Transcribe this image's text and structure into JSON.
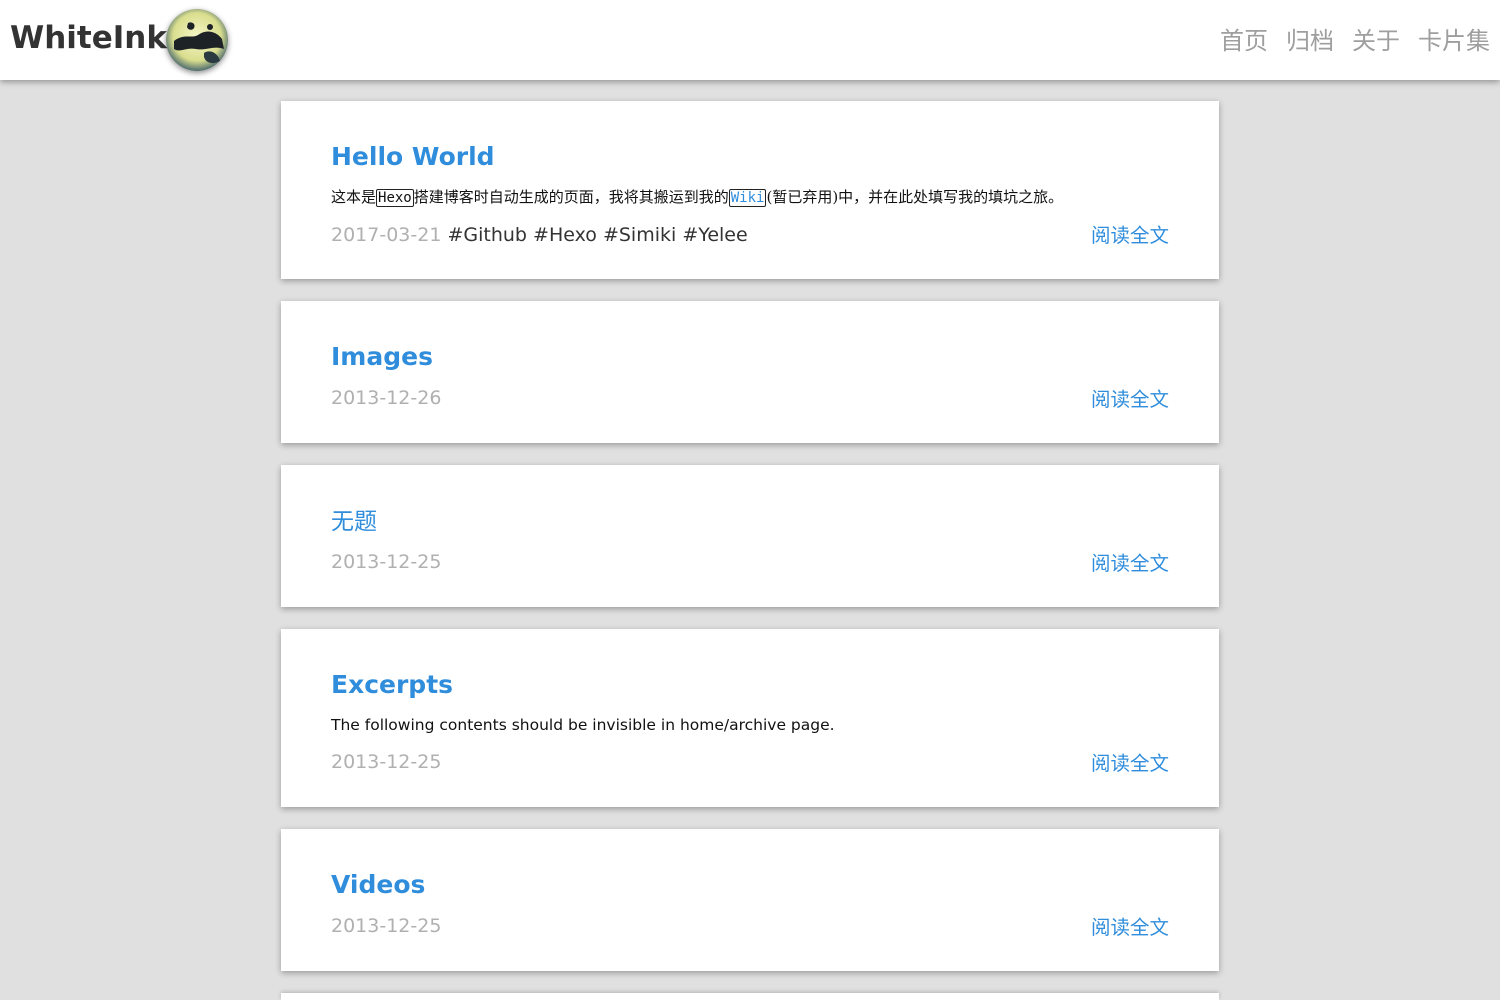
{
  "header": {
    "site_title": "WhiteInk",
    "nav": [
      "首页",
      "归档",
      "关于",
      "卡片集"
    ]
  },
  "colors": {
    "accent": "#2f8ddc",
    "date": "#b0b0b0",
    "nav": "#9e9e9e",
    "background": "#e0e0e0"
  },
  "posts": [
    {
      "title": "Hello World",
      "excerpt": {
        "p1": "这本是",
        "code1": "Hexo",
        "p2": "搭建博客时自动生成的页面，我将其搬运到我的",
        "link": "Wiki",
        "p3": "(暂已弃用)中，并在此处填写我的填坑之旅。"
      },
      "date": "2017-03-21",
      "tags": [
        "#Github",
        "#Hexo",
        "#Simiki",
        "#Yelee"
      ],
      "read_more": "阅读全文"
    },
    {
      "title": "Images",
      "date": "2013-12-26",
      "read_more": "阅读全文"
    },
    {
      "title": "无题",
      "date": "2013-12-25",
      "read_more": "阅读全文"
    },
    {
      "title": "Excerpts",
      "excerpt_text": "The following contents should be invisible in home/archive page.",
      "date": "2013-12-25",
      "read_more": "阅读全文"
    },
    {
      "title": "Videos",
      "date": "2013-12-25",
      "read_more": "阅读全文"
    }
  ]
}
